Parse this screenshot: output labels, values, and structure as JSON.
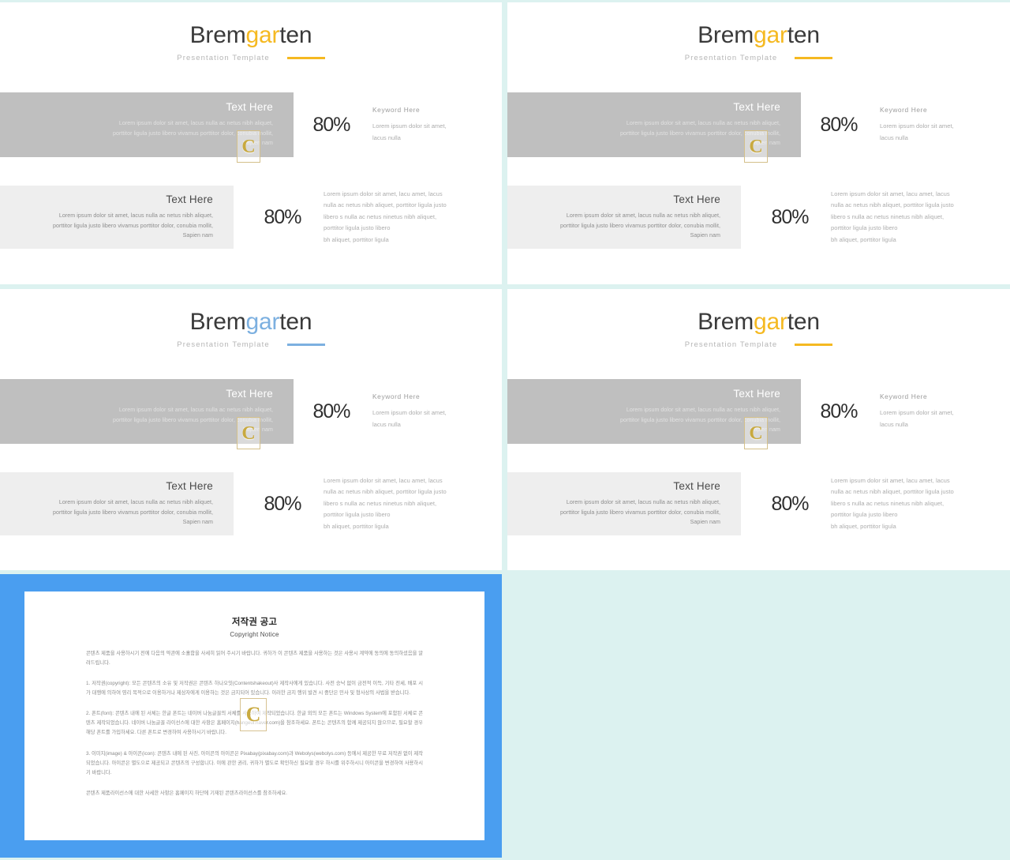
{
  "page": {
    "background_color": "#dcf2f0",
    "accent_yellow": "#f5b921",
    "accent_blue": "#7cb0e0",
    "frame_blue": "#4a9ef0",
    "box_dark": "#bfbfbf",
    "box_light": "#eeeeee"
  },
  "brand": {
    "part1": "Brem",
    "accent": "gar",
    "part3": "ten",
    "subtitle": "Presentation  Template"
  },
  "content": {
    "box_title": "Text Here",
    "box_body_line1": "Lorem ipsum dolor sit amet, lacus nulla ac netus nibh aliquet,",
    "box_body_line2": "porttitor  ligula justo libero vivamus porttitor  dolor, conubia mollit,",
    "box_body_line3": "Sapien nam",
    "percent": "80%",
    "keyword": "Keyword  Here",
    "side_body_line1": "Lorem ipsum dolor sit amet,",
    "side_body_line2": "lacus nulla",
    "wide_body_line1": "Lorem ipsum dolor sit amet, lacu amet, lacus",
    "wide_body_line2": "nulla ac netus nibh aliquet,  porttitor ligula  justo",
    "wide_body_line3": "libero s nulla ac netus ninetus nibh  aliquet,",
    "wide_body_line4": "porttitor ligula  justo libero",
    "wide_body_line5": "bh aliquet,  porttitor ligula",
    "watermark_glyph": "C"
  },
  "copyright": {
    "title_ko": "저작권 공고",
    "title_en": "Copyright Notice",
    "intro": "콘텐츠 제품을 사용하시기 전에 다음의 약관에 소홀함을 사세히 읽어 주시기 바랍니다. 귀하가 이 콘텐츠 제품을 사용하는 것은 사용시 계약에 동의에 동의하셨음을 알려드립니다.",
    "section1": "1. 저작권(copyright): 모든 콘텐츠의 소유 및 저작권은 콘텐츠 하나오잇(Contentshakeout)사 제작사에게 있습니다. 사전 승낙 없이 금전적 이득, 기타 전세, 배포 시가 대행에 의하여 영리 목적으로 이용하거나 제삼자에게 이용하는 것은 금지되어 있습니다. 이러한 금지 행위 발견 시 중단은 민사 및 형사상의 사법을 받습니다.",
    "section2": "2. 폰트(font): 콘텐츠 내에 된 서체는 한글 폰트는 네이버 나눔글꼴의 서체를 사용하여 제작되었습니다. 한글 외의 모든 폰트는 Windows System에 포함된 서체로 콘텐츠 제작되었습니다. 네이버 나눔글꼴 라이선스에 대한 사항은 홈페이지(hangeul.naver.com)을 참조하세요. 폰트는 콘텐츠의 함께 제공되지 않으므로, 필요할 경우 해당 폰트를 가입하세요. 다른 폰트로 변경하여 사용하시기 바랍니다.",
    "section3": "3. 이미지(image) & 아이콘(icon): 콘텐츠 내에 된 사진, 아이콘의 아이콘은 Pixabay(pixabay.com)과 Webolys(webolys.com) 등에서 제공한 무료 저작권 없이 제작되었습니다. 아이콘은 별도으로 제공되고 콘텐츠의 구성합니다. 이에 관한 권리, 귀하가 별도로 확인하신 필요할 경우 하시를 위주하시니 아이콘을 변경하여 사용하시기 바랍니다.",
    "footer": "콘텐츠 제품라이선스에 대한 사세한 사항은 홈페이지 하단에 기재된 콘텐츠라이선스를 참조하세요.",
    "watermark_glyph": "C"
  }
}
